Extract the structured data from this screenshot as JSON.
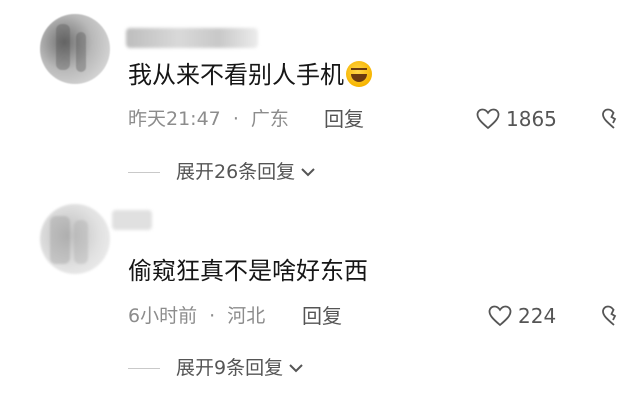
{
  "comments": [
    {
      "username": "",
      "text": "我从来不看别人手机",
      "emoji": "rolling-on-floor-laughing-emoji",
      "time": "昨天21:47",
      "location": "广东",
      "reply_label": "回复",
      "likes": "1865",
      "expand_label": "展开26条回复"
    },
    {
      "username": "",
      "text": "偷窥狂真不是啥好东西",
      "time": "6小时前",
      "location": "河北",
      "reply_label": "回复",
      "likes": "224",
      "expand_label": "展开9条回复"
    }
  ],
  "separator": "·",
  "icons": {
    "like": "heart-outline-icon",
    "dislike": "broken-heart-icon",
    "expand": "chevron-down-icon"
  },
  "colors": {
    "text_primary": "#161616",
    "text_meta": "#8c8c8c",
    "text_action": "#555555",
    "background": "#ffffff"
  }
}
